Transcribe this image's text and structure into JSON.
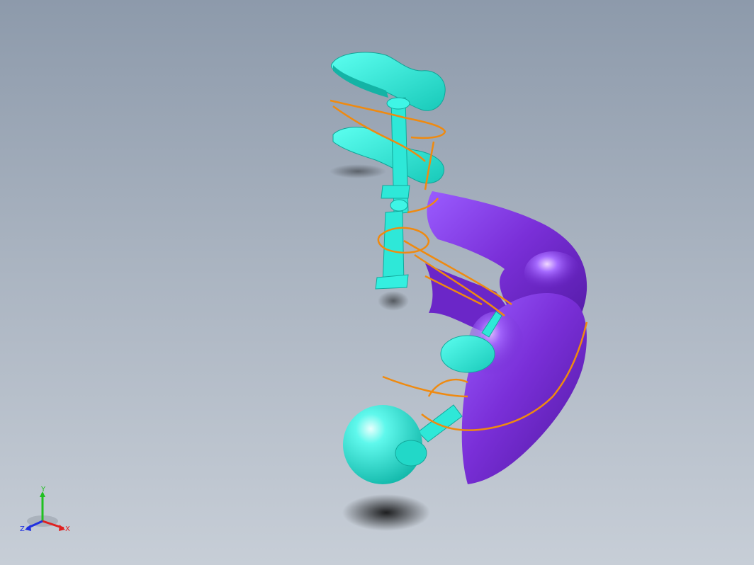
{
  "viewport": {
    "background_top": "#8d9aab",
    "background_bottom": "#c7ced7"
  },
  "model": {
    "parts": [
      {
        "name": "upper-footplate",
        "color": "#2ef2e0"
      },
      {
        "name": "lower-footplate",
        "color": "#2ef2e0"
      },
      {
        "name": "central-strut",
        "color": "#2ef2e0"
      },
      {
        "name": "shell-upper",
        "color": "#7a2fd8"
      },
      {
        "name": "shell-lower",
        "color": "#7a2fd8"
      },
      {
        "name": "wire-curves",
        "color": "#ef8a10"
      },
      {
        "name": "ball-joint",
        "color": "#2ef2e0"
      },
      {
        "name": "hinge-disc",
        "color": "#2ef2e0"
      }
    ]
  },
  "triad": {
    "x_label": "X",
    "y_label": "Y",
    "z_label": "Z",
    "x_color": "#e02020",
    "y_color": "#20c020",
    "z_color": "#2030e0"
  }
}
